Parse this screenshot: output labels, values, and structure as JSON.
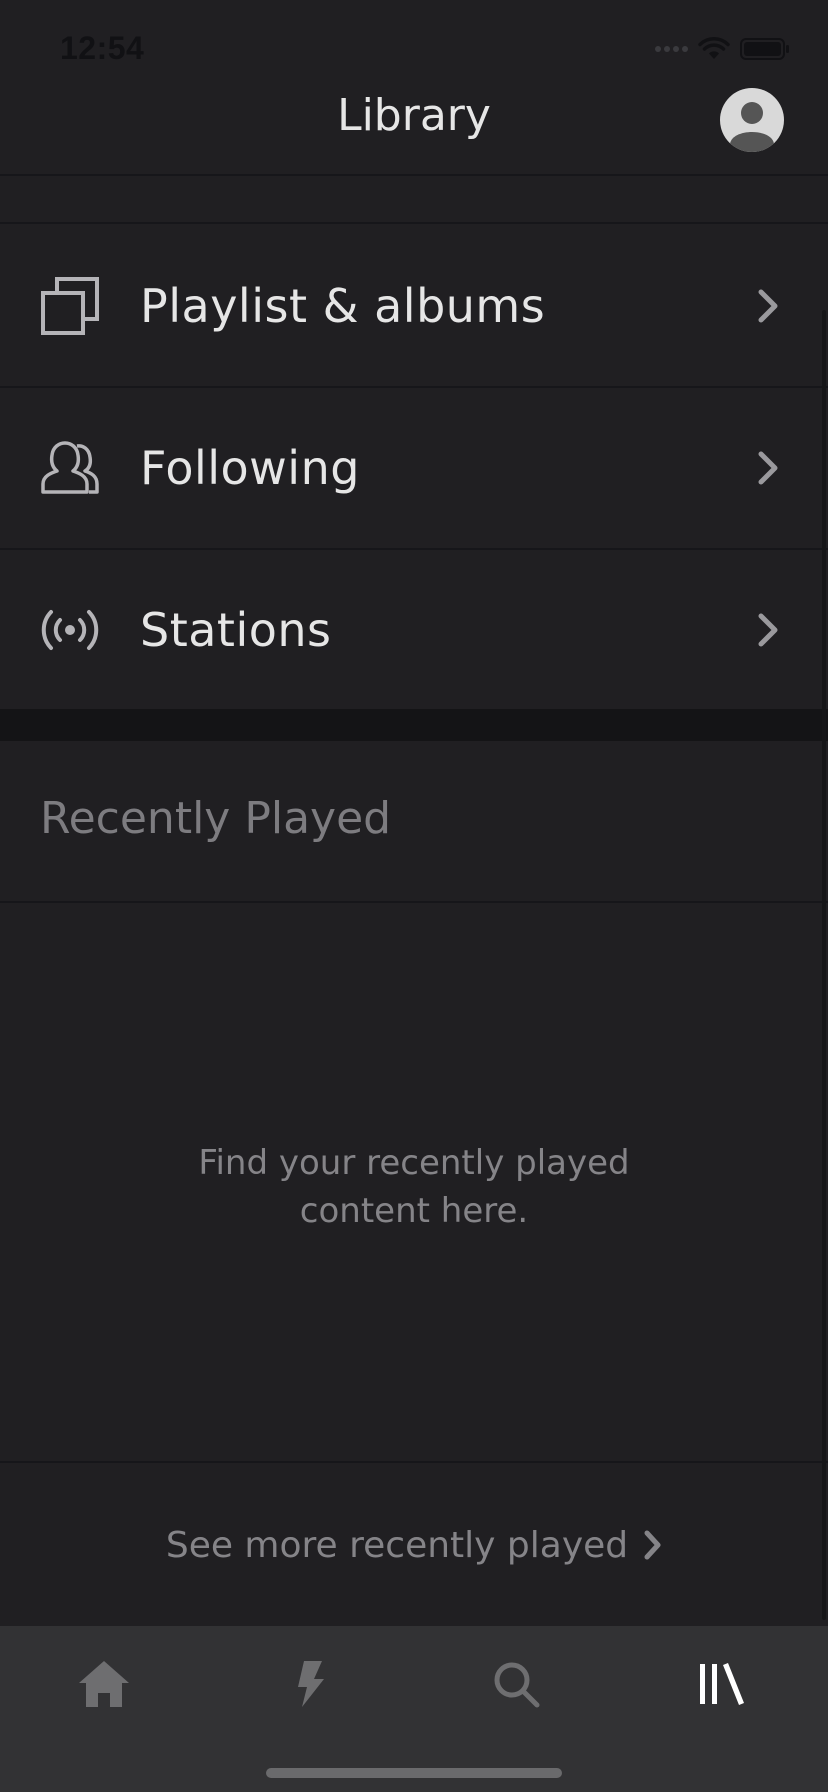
{
  "status_bar": {
    "time": "12:54"
  },
  "header": {
    "title": "Library",
    "avatar_icon": "user-avatar-icon"
  },
  "menu": {
    "items": [
      {
        "label": "Playlist & albums",
        "icon": "stacked-squares-icon"
      },
      {
        "label": "Following",
        "icon": "people-icon"
      },
      {
        "label": "Stations",
        "icon": "radio-broadcast-icon"
      }
    ]
  },
  "recently_played": {
    "title": "Recently Played",
    "empty_message": "Find your recently played\ncontent here.",
    "see_more_label": "See more recently played"
  },
  "tab_bar": {
    "tabs": [
      {
        "icon": "home-icon",
        "active": false
      },
      {
        "icon": "lightning-icon",
        "active": false
      },
      {
        "icon": "search-icon",
        "active": false
      },
      {
        "icon": "library-icon",
        "active": true
      }
    ]
  },
  "colors": {
    "background": "#201f22",
    "divider": "#16161a",
    "section_divider": "#141416",
    "tab_bar": "#323234",
    "text_primary": "#e6e6e6",
    "text_muted": "#858488",
    "icon_inactive": "#6e6e70",
    "icon_active": "#ffffff"
  }
}
